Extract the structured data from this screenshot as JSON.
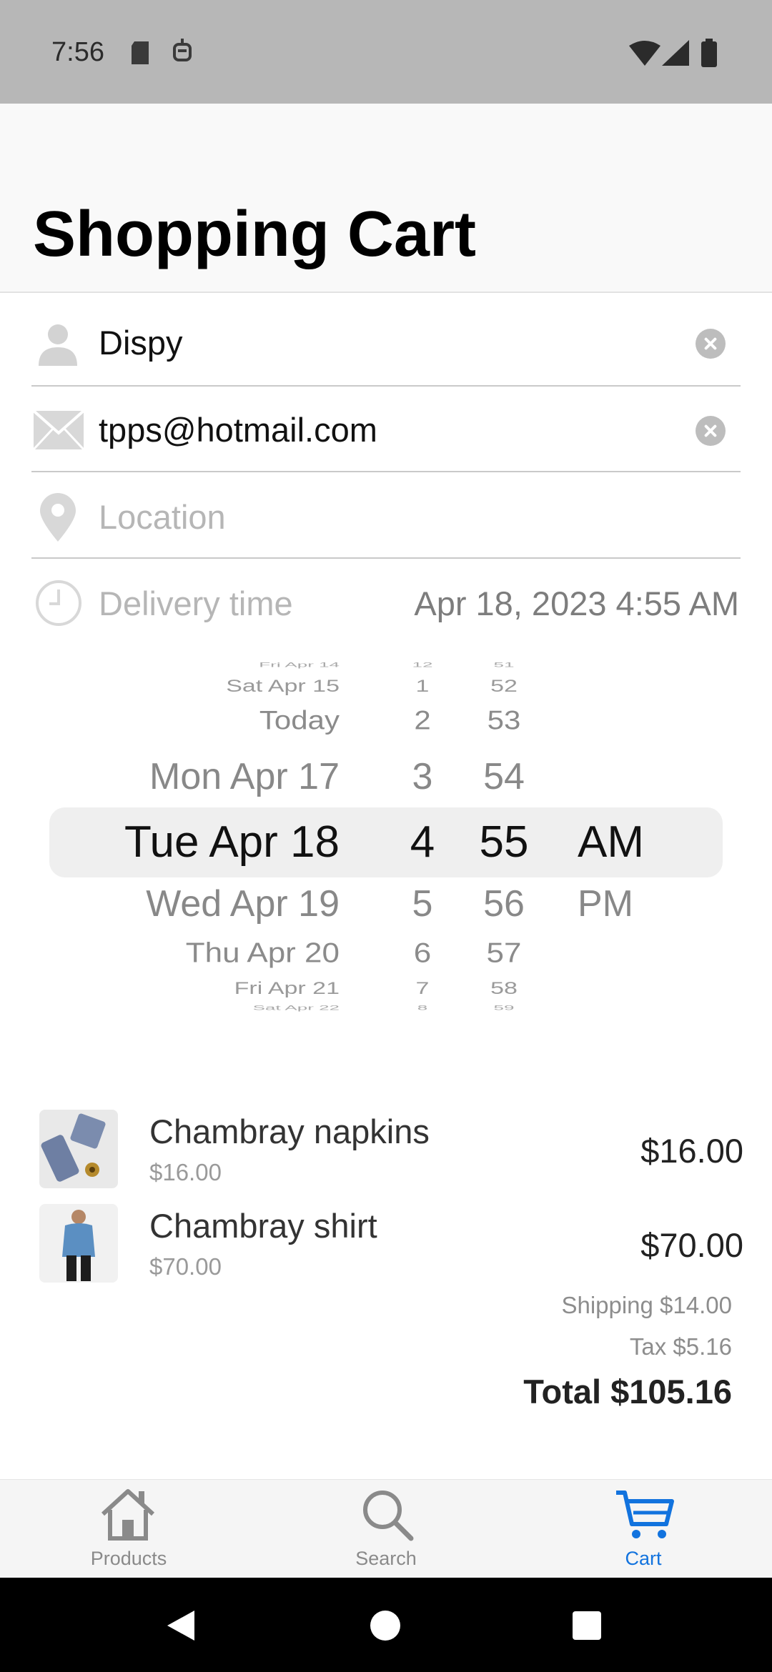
{
  "status_bar": {
    "time": "7:56"
  },
  "header": {
    "title": "Shopping Cart"
  },
  "form": {
    "name_value": "Dispy",
    "email_value": "tpps@hotmail.com",
    "location_placeholder": "Location",
    "delivery_label": "Delivery time",
    "delivery_value": "Apr 18, 2023 4:55 AM"
  },
  "picker": {
    "dates": [
      "Fri Apr 14",
      "Sat Apr 15",
      "Today",
      "Mon Apr 17",
      "Tue Apr 18",
      "Wed Apr 19",
      "Thu Apr 20",
      "Fri Apr 21",
      "Sat Apr 22"
    ],
    "hours": [
      "12",
      "1",
      "2",
      "3",
      "4",
      "5",
      "6",
      "7",
      "8"
    ],
    "minutes": [
      "51",
      "52",
      "53",
      "54",
      "55",
      "56",
      "57",
      "58",
      "59"
    ],
    "ampm": [
      "AM",
      "PM"
    ]
  },
  "cart": {
    "items": [
      {
        "name": "Chambray napkins",
        "unit_price": "$16.00",
        "line_total": "$16.00"
      },
      {
        "name": "Chambray shirt",
        "unit_price": "$70.00",
        "line_total": "$70.00"
      }
    ],
    "shipping": "Shipping $14.00",
    "tax": "Tax $5.16",
    "total": "Total $105.16"
  },
  "nav": {
    "products": "Products",
    "search": "Search",
    "cart": "Cart",
    "active_color": "#1273de"
  }
}
